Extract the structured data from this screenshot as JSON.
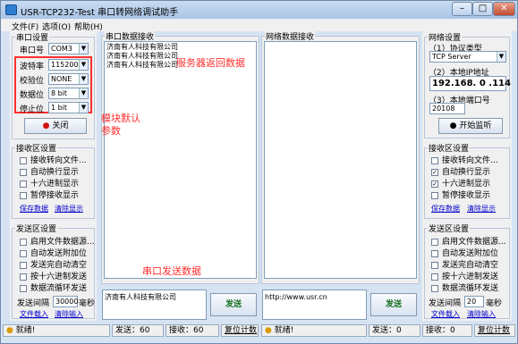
{
  "window": {
    "title": "USR-TCP232-Test 串口转网络调试助手",
    "minimize": "–",
    "maximize": "□",
    "close": "✕"
  },
  "menu": [
    "文件(F)",
    "选项(O)",
    "帮助(H)"
  ],
  "serial": {
    "title": "串口设置",
    "port_label": "串口号",
    "port_value": "COM3",
    "baud_label": "波特率",
    "baud_value": "115200",
    "parity_label": "校验位",
    "parity_value": "NONE",
    "data_label": "数据位",
    "data_value": "8 bit",
    "stop_label": "停止位",
    "stop_value": "1 bit",
    "close_button": "关闭"
  },
  "left_receive": {
    "title": "接收区设置",
    "options": [
      {
        "label": "接收转向文件...",
        "checked": false
      },
      {
        "label": "自动换行显示",
        "checked": false
      },
      {
        "label": "十六进制显示",
        "checked": false
      },
      {
        "label": "暂停接收显示",
        "checked": false
      }
    ],
    "save_link": "保存数据",
    "clear_link": "清除显示"
  },
  "left_send": {
    "title": "发送区设置",
    "options": [
      {
        "label": "启用文件数据源...",
        "checked": false
      },
      {
        "label": "自动发送附加位",
        "checked": false
      },
      {
        "label": "发送完自动清空",
        "checked": false
      },
      {
        "label": "按十六进制发送",
        "checked": false
      },
      {
        "label": "数据流循环发送",
        "checked": false
      }
    ],
    "interval_label": "发送间隔",
    "interval_value": "30000",
    "interval_unit": "毫秒",
    "load_link": "文件载入",
    "clear_link": "清除输入"
  },
  "serial_receive": {
    "title": "串口数据接收",
    "lines": [
      "济南有人科技有限公司",
      "济南有人科技有限公司",
      "济南有人科技有限公司"
    ]
  },
  "network_receive": {
    "title": "网络数据接收"
  },
  "serial_send": {
    "value": "济南有人科技有限公司",
    "button": "发送"
  },
  "network_send": {
    "value": "http://www.usr.cn",
    "button": "发送"
  },
  "network": {
    "title": "网络设置",
    "protocol_label": "（1）协议类型",
    "protocol_value": "TCP Server",
    "ip_label": "（2）本地IP地址",
    "ip_value": "192.168. 0 .114",
    "port_label": "（3）本地端口号",
    "port_value": "20108",
    "start_button": "开始监听"
  },
  "right_receive": {
    "title": "接收区设置",
    "options": [
      {
        "label": "接收转向文件...",
        "checked": false
      },
      {
        "label": "自动换行显示",
        "checked": true
      },
      {
        "label": "十六进制显示",
        "checked": true
      },
      {
        "label": "暂停接收显示",
        "checked": false
      }
    ],
    "save_link": "保存数据",
    "clear_link": "清除显示"
  },
  "right_send": {
    "title": "发送区设置",
    "options": [
      {
        "label": "启用文件数据源...",
        "checked": false
      },
      {
        "label": "自动发送附加位",
        "checked": false
      },
      {
        "label": "发送完自动清空",
        "checked": false
      },
      {
        "label": "按十六进制发送",
        "checked": false
      },
      {
        "label": "数据流循环发送",
        "checked": false
      }
    ],
    "interval_label": "发送间隔",
    "interval_value": "20",
    "interval_unit": "毫秒",
    "load_link": "文件载入",
    "clear_link": "清除输入"
  },
  "annotations": {
    "server_data": "服务器返回数据",
    "module_default_line1": "模块默认",
    "module_default_line2": "参数",
    "serial_send": "串口发送数据"
  },
  "statusbar": {
    "left_ready": "就绪!",
    "left_send": "发送：60",
    "left_recv": "接收：60",
    "left_reset": "复位计数",
    "right_ready": "就绪!",
    "right_send": "发送：0",
    "right_recv": "接收：0",
    "right_reset": "复位计数"
  },
  "colors": {
    "annotation": "#ff3030",
    "link": "#0000cc",
    "title_gradient_top": "#c9dcf2",
    "title_gradient_bottom": "#a9c4e6"
  }
}
